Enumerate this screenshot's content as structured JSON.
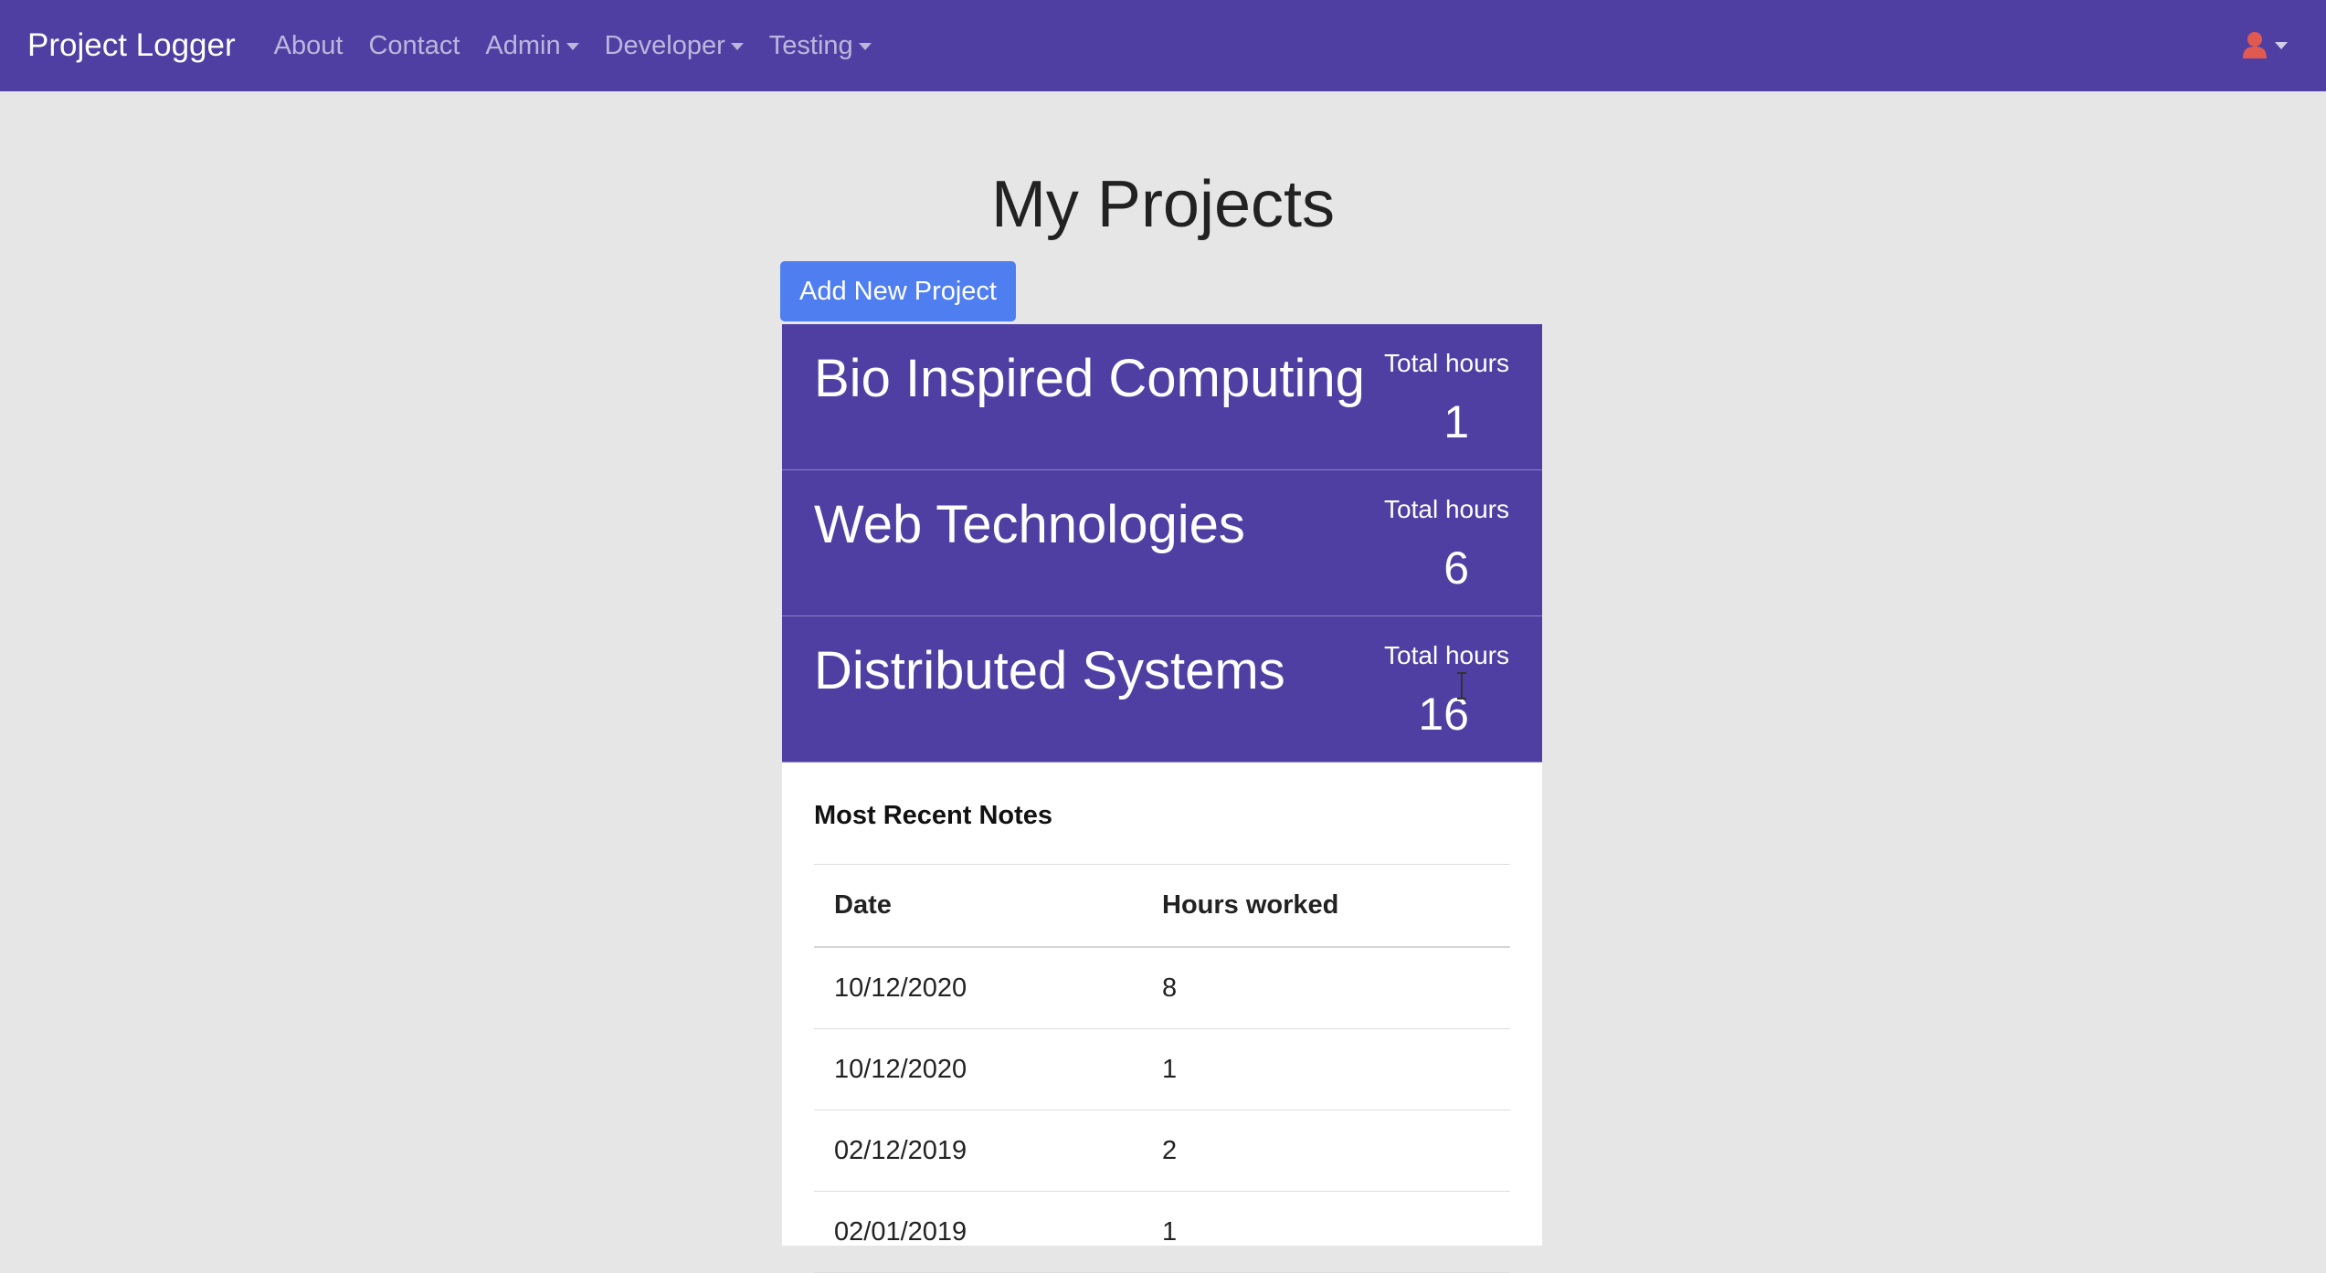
{
  "navbar": {
    "brand": "Project Logger",
    "links": [
      {
        "label": "About",
        "dropdown": false
      },
      {
        "label": "Contact",
        "dropdown": false
      },
      {
        "label": "Admin",
        "dropdown": true
      },
      {
        "label": "Developer",
        "dropdown": true
      },
      {
        "label": "Testing",
        "dropdown": true
      }
    ],
    "user_icon": "user-icon",
    "user_icon_color": "#e05a52",
    "background": "#4f3fa3"
  },
  "main": {
    "title": "My Projects",
    "add_button_label": "Add New Project",
    "add_button_color": "#4f7ef0"
  },
  "projects": [
    {
      "name": "Bio Inspired Computing",
      "hours_label": "Total hours",
      "hours": "1"
    },
    {
      "name": "Web Technologies",
      "hours_label": "Total hours",
      "hours": "6"
    },
    {
      "name": "Distributed Systems",
      "hours_label": "Total hours",
      "hours": "16"
    }
  ],
  "notes": {
    "title": "Most Recent Notes",
    "columns": [
      "Date",
      "Hours worked"
    ],
    "rows": [
      {
        "date": "10/12/2020",
        "hours": "8"
      },
      {
        "date": "10/12/2020",
        "hours": "1"
      },
      {
        "date": "02/12/2019",
        "hours": "2"
      },
      {
        "date": "02/01/2019",
        "hours": "1"
      }
    ]
  }
}
